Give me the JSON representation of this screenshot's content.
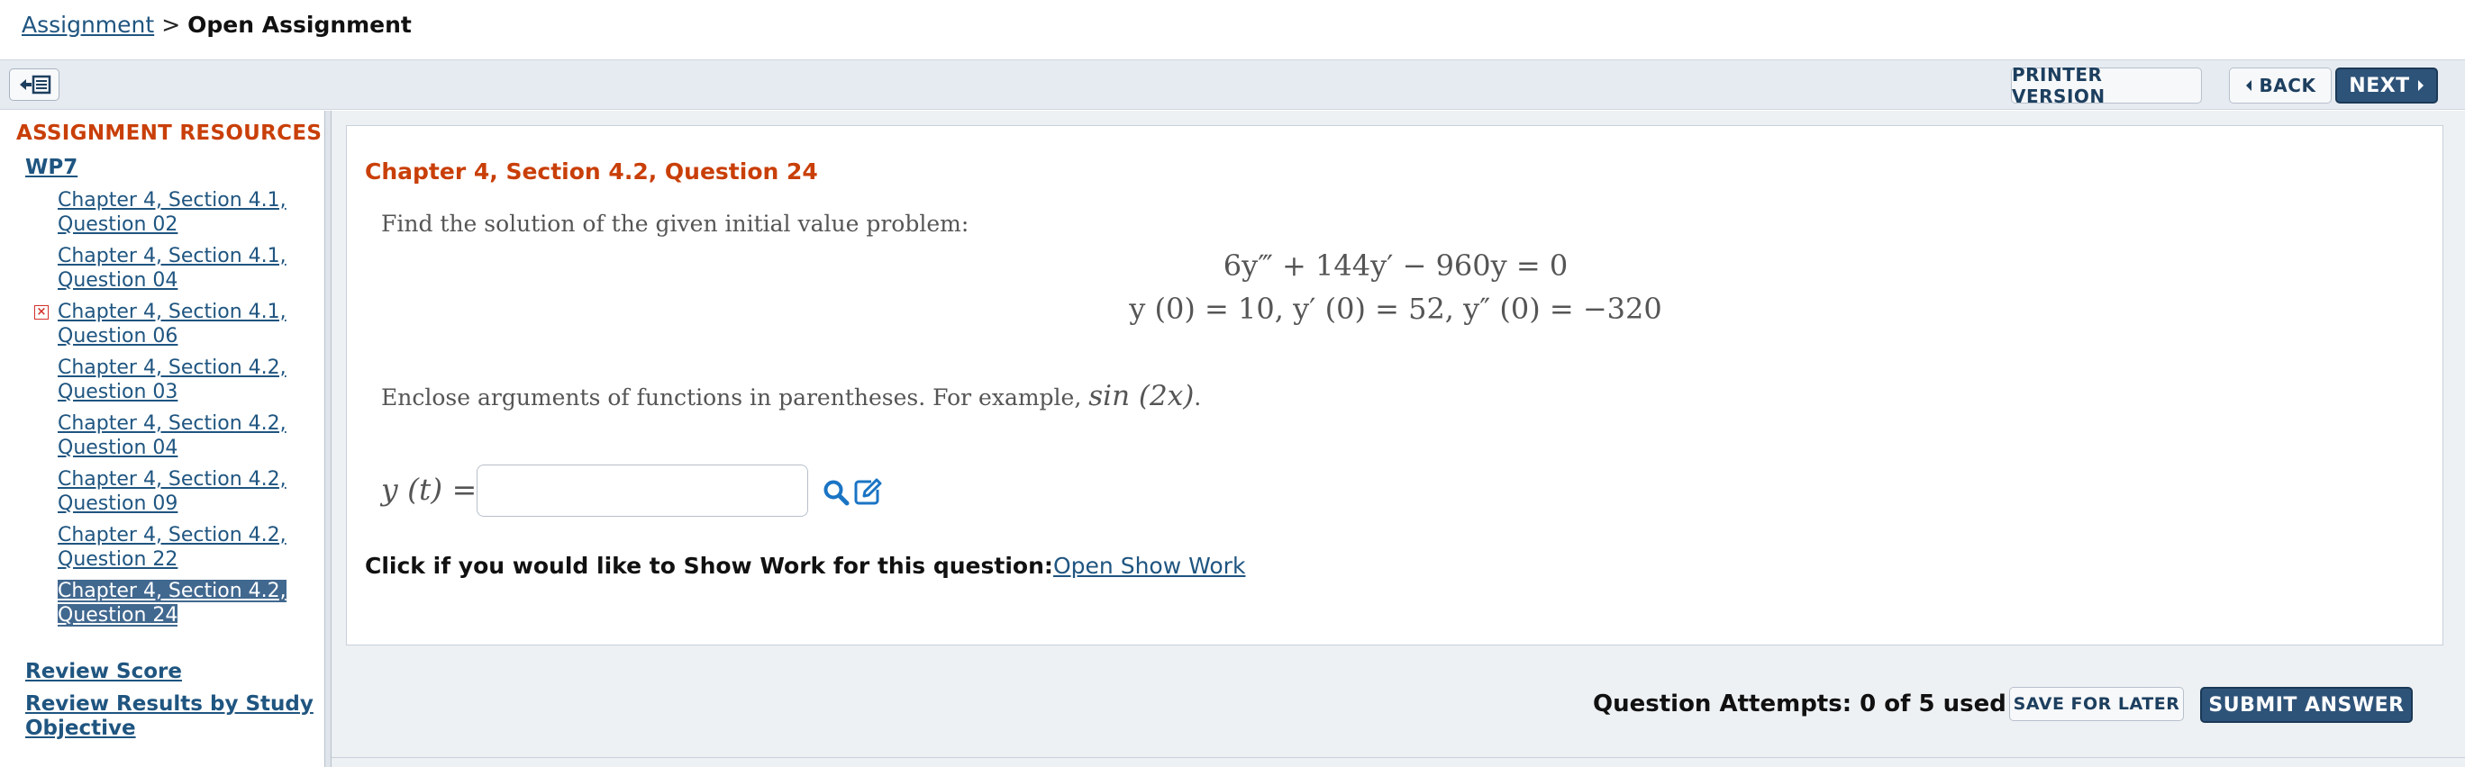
{
  "breadcrumb": {
    "parent": "Assignment",
    "separator": ">",
    "current": "Open Assignment"
  },
  "toolbar": {
    "collapse_icon": "sidebar-collapse-icon",
    "printer_label": "PRINTER VERSION",
    "back_label": "BACK",
    "next_label": "NEXT"
  },
  "sidebar": {
    "title": "ASSIGNMENT RESOURCES",
    "section": "WP7",
    "items": [
      {
        "label": "Chapter 4, Section 4.1, Question 02",
        "status": ""
      },
      {
        "label": "Chapter 4, Section 4.1, Question 04",
        "status": ""
      },
      {
        "label": "Chapter 4, Section 4.1, Question 06",
        "status": "incorrect"
      },
      {
        "label": "Chapter 4, Section 4.2, Question 03",
        "status": ""
      },
      {
        "label": "Chapter 4, Section 4.2, Question 04",
        "status": ""
      },
      {
        "label": "Chapter 4, Section 4.2, Question 09",
        "status": ""
      },
      {
        "label": "Chapter 4, Section 4.2, Question 22",
        "status": ""
      },
      {
        "label": "Chapter 4, Section 4.2, Question 24",
        "status": "active"
      }
    ],
    "review_score": "Review Score",
    "review_results": "Review Results by Study Objective"
  },
  "question": {
    "title": "Chapter 4, Section 4.2, Question 24",
    "prompt": "Find the solution of the given initial value problem:",
    "equation": "6y‴ + 144y′ − 960y = 0",
    "initial_conditions": "y (0) = 10,  y′ (0) = 52,  y″ (0) = −320",
    "hint_text": "Enclose arguments of functions in parentheses. For example,",
    "hint_example": "sin (2x)",
    "hint_end": ".",
    "answer_label": "y (t) =",
    "answer_value": "",
    "show_work_label": "Click if you would like to Show Work for this question:",
    "show_work_link": "Open Show Work"
  },
  "footer": {
    "attempts": "Question Attempts: 0 of 5 used",
    "save_label": "SAVE FOR LATER",
    "submit_label": "SUBMIT ANSWER"
  },
  "colors": {
    "accent_orange": "#c93f08",
    "link_blue": "#1f5580",
    "primary_button": "#2e5379",
    "icon_blue": "#1a74c4"
  }
}
